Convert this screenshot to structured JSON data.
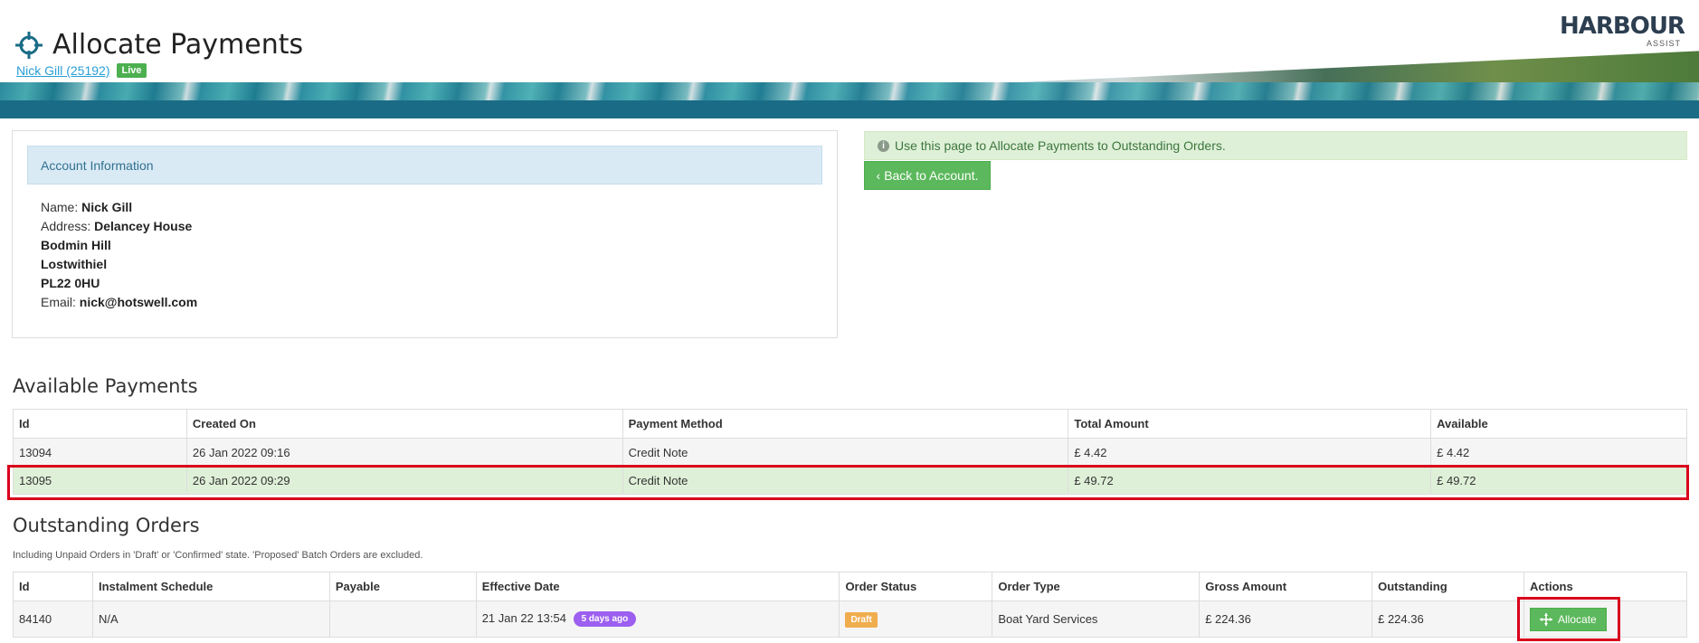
{
  "header": {
    "title": "Allocate Payments",
    "account_link": "Nick Gill (25192)",
    "status_badge": "Live",
    "logo_text": "HARBOUR",
    "logo_sub": "ASSIST"
  },
  "account_info": {
    "heading": "Account Information",
    "name_label": "Name:",
    "name": "Nick Gill",
    "address_label": "Address:",
    "address_lines": [
      "Delancey House",
      "Bodmin Hill",
      "Lostwithiel",
      "PL22 0HU"
    ],
    "email_label": "Email:",
    "email": "nick@hotswell.com"
  },
  "info_message": "Use this page to Allocate Payments to Outstanding Orders.",
  "back_button": "Back to Account.",
  "available_payments": {
    "title": "Available Payments",
    "columns": [
      "Id",
      "Created On",
      "Payment Method",
      "Total Amount",
      "Available"
    ],
    "rows": [
      {
        "id": "13094",
        "created_on": "26 Jan 2022 09:16",
        "method": "Credit Note",
        "total": "£ 4.42",
        "available": "£ 4.42"
      },
      {
        "id": "13095",
        "created_on": "26 Jan 2022 09:29",
        "method": "Credit Note",
        "total": "£ 49.72",
        "available": "£ 49.72"
      }
    ]
  },
  "outstanding_orders": {
    "title": "Outstanding Orders",
    "hint": "Including Unpaid Orders in 'Draft' or 'Confirmed' state. 'Proposed' Batch Orders are excluded.",
    "columns": [
      "Id",
      "Instalment Schedule",
      "Payable",
      "Effective Date",
      "Order Status",
      "Order Type",
      "Gross Amount",
      "Outstanding",
      "Actions"
    ],
    "rows": [
      {
        "id": "84140",
        "instalment": "N/A",
        "payable": "",
        "effective_date": "21 Jan 22 13:54",
        "age_badge": "5 days ago",
        "status": "Draft",
        "type": "Boat Yard Services",
        "gross": "£ 224.36",
        "outstanding": "£ 224.36",
        "action_label": "Allocate"
      }
    ]
  },
  "colors": {
    "primary_blue": "#1a6c86",
    "success_green": "#5cb85c",
    "warning_orange": "#f0ad4e",
    "badge_purple": "#9c5ff0",
    "highlight_red": "#d9001b"
  }
}
